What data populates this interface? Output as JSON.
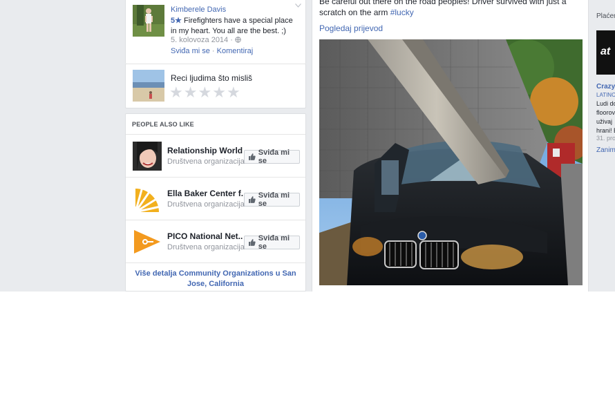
{
  "review": {
    "author": "Kimberele Davis",
    "stars": "5★",
    "text": "Firefighters have a special place in my heart. You all are the best. ;)",
    "date": "5. kolovoza 2014 ·",
    "like_label": "Sviđa mi se",
    "separator": "·",
    "comment_label": "Komentiraj"
  },
  "rate": {
    "prompt": "Reci ljudima što misliš",
    "star_count": 5
  },
  "people_also_like": {
    "header": "PEOPLE ALSO LIKE",
    "items": [
      {
        "name": "Relationship World",
        "category": "Društvena organizacija",
        "button": "Sviđa mi se"
      },
      {
        "name": "Ella Baker Center f...",
        "category": "Društvena organizacija",
        "button": "Sviđa mi se"
      },
      {
        "name": "PICO National Net...",
        "category": "Društvena organizacija",
        "button": "Sviđa mi se"
      }
    ],
    "more_link": "Više detalja Community Organizations u San Jose, California"
  },
  "post": {
    "text": "Be careful out there on the road peoples! Driver survived with just a scratch on the arm",
    "hashtag": "#lucky",
    "translate": "Pogledaj prijevod"
  },
  "right": {
    "header": "Plaćen",
    "ad_logo": "at",
    "ad_title": "Crazy",
    "ad_site": "LATINC",
    "ad_desc_1": "Ludi do",
    "ad_desc_2": "floorov",
    "ad_desc_3": "uživaj",
    "ad_desc_4": "hrani! E",
    "ad_date": "31. pro",
    "ad_link": "Zanim"
  },
  "colors": {
    "link": "#4267b2",
    "background": "#e9ebee",
    "muted": "#90949c"
  }
}
